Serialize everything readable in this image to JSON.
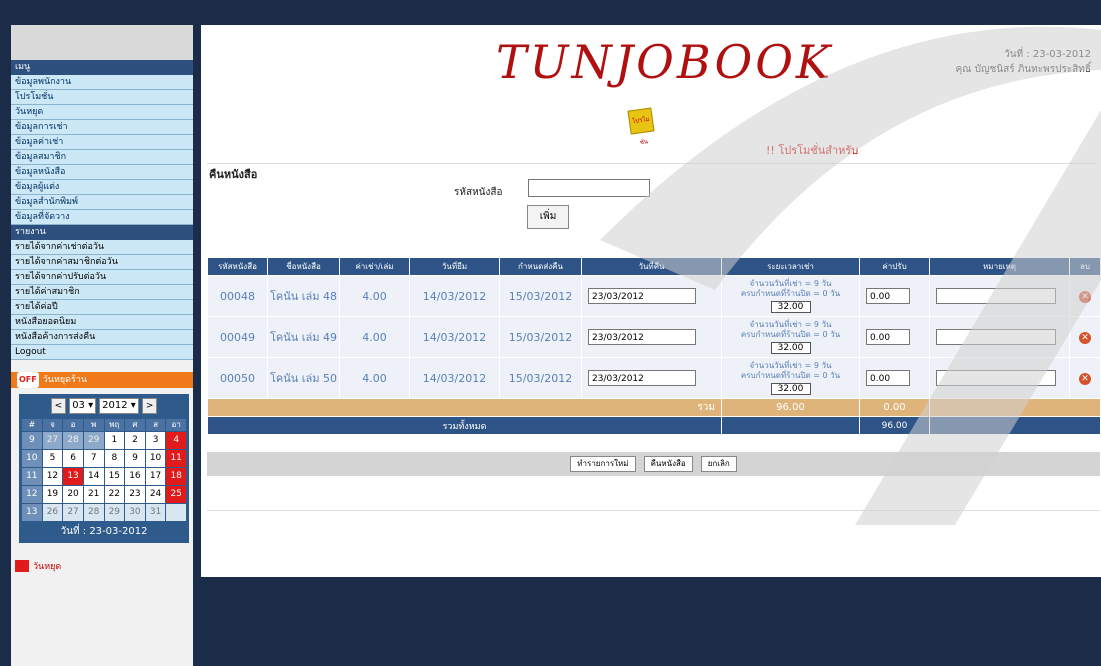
{
  "sidebar": {
    "menu_header": "เมนู",
    "menu_items": [
      "ข้อมูลพนักงาน",
      "โปรโมชั่น",
      "วันหยุด",
      "ข้อมูลการเช่า",
      "ข้อมูลค่าเช่า",
      "ข้อมูลสมาชิก",
      "ข้อมูลหนังสือ",
      "ข้อมูลผู้แต่ง",
      "ข้อมูลสำนักพิมพ์",
      "ข้อมูลที่จัดวาง"
    ],
    "report_header": "รายงาน",
    "report_items": [
      "รายได้จากค่าเช่าต่อวัน",
      "รายได้จากค่าสมาชิกต่อวัน",
      "รายได้จากค่าปรับต่อวัน",
      "รายได้ค่าสมาชิก",
      "รายได้ค่อปี",
      "หนังสือยอดนิยม",
      "หนังสือค้างการส่งคืน",
      "Logout"
    ],
    "calendar_badge": "OFF",
    "calendar_title": "วันหยุดร้าน",
    "calendar": {
      "prev": "<",
      "next": ">",
      "month": "03",
      "year": "2012",
      "headers": [
        "#",
        "จ",
        "อ",
        "พ",
        "พฤ",
        "ศ",
        "ส",
        "อา"
      ],
      "rows": [
        [
          "9",
          "27",
          "28",
          "29",
          "1",
          "2",
          "3",
          "4"
        ],
        [
          "10",
          "5",
          "6",
          "7",
          "8",
          "9",
          "10",
          "11"
        ],
        [
          "11",
          "12",
          "13",
          "14",
          "15",
          "16",
          "17",
          "18"
        ],
        [
          "12",
          "19",
          "20",
          "21",
          "22",
          "23",
          "24",
          "25"
        ],
        [
          "13",
          "26",
          "27",
          "28",
          "29",
          "30",
          "31",
          ""
        ]
      ],
      "today_label": "วันที่ : 23-03-2012"
    },
    "legend_label": "วันหยุด"
  },
  "header": {
    "logo": "TUNJOBOOK",
    "date": "วันที่ : 23-03-2012",
    "user": "คุณ บัญชนิสร์ ภินทะพรประสิทธิ์",
    "promo_icon_label": "โปรโมชั่น",
    "promo_text": "!! โปรโมชั่นสำหรับ"
  },
  "form": {
    "section_title": "คืนหนังสือ",
    "book_id_label": "รหัสหนังสือ",
    "book_id_value": "",
    "add_button": "เพิ่ม"
  },
  "table": {
    "headers": [
      "รหัสหนังสือ",
      "ชื่อหนังสือ",
      "ค่าเช่า/เล่ม",
      "วันที่ยืม",
      "กำหนดส่งคืน",
      "วันที่คืน",
      "ระยะเวลาเช่า",
      "ค่าปรับ",
      "หมายเหตุ",
      "ลบ"
    ],
    "rows": [
      {
        "id": "00048",
        "name": "โคนัน เล่ม 48",
        "rate": "4.00",
        "borrow": "14/03/2012",
        "due": "15/03/2012",
        "return": "23/03/2012",
        "period_line1": "จำนวนวันที่เช่า = 9 วัน",
        "period_line2": "ครบกำหนดที่ร้านปิด = 0 วัน",
        "days": "32.00",
        "fine": "0.00",
        "note": ""
      },
      {
        "id": "00049",
        "name": "โคนัน เล่ม 49",
        "rate": "4.00",
        "borrow": "14/03/2012",
        "due": "15/03/2012",
        "return": "23/03/2012",
        "period_line1": "จำนวนวันที่เช่า = 9 วัน",
        "period_line2": "ครบกำหนดที่ร้านปิด = 0 วัน",
        "days": "32.00",
        "fine": "0.00",
        "note": ""
      },
      {
        "id": "00050",
        "name": "โคนัน เล่ม 50",
        "rate": "4.00",
        "borrow": "14/03/2012",
        "due": "15/03/2012",
        "return": "23/03/2012",
        "period_line1": "จำนวนวันที่เช่า = 9 วัน",
        "period_line2": "ครบกำหนดที่ร้านปิด = 0 วัน",
        "days": "32.00",
        "fine": "0.00",
        "note": ""
      }
    ],
    "sum_label": "รวม",
    "sum_rent": "96.00",
    "sum_fine": "0.00",
    "total_label": "รวมทั้งหมด",
    "total_value": "96.00"
  },
  "actions": {
    "new_button": "ทำรายการใหม่",
    "return_button": "คืนหนังสือ",
    "cancel_button": "ยกเลิก"
  },
  "colors": {
    "page_bg": "#1b2c49",
    "header_blue": "#2e5487",
    "menu_bg": "#cce7f5",
    "sum_row": "#dfb47a",
    "promo_red": "#d40000",
    "calendar_orange": "#f07a19"
  }
}
